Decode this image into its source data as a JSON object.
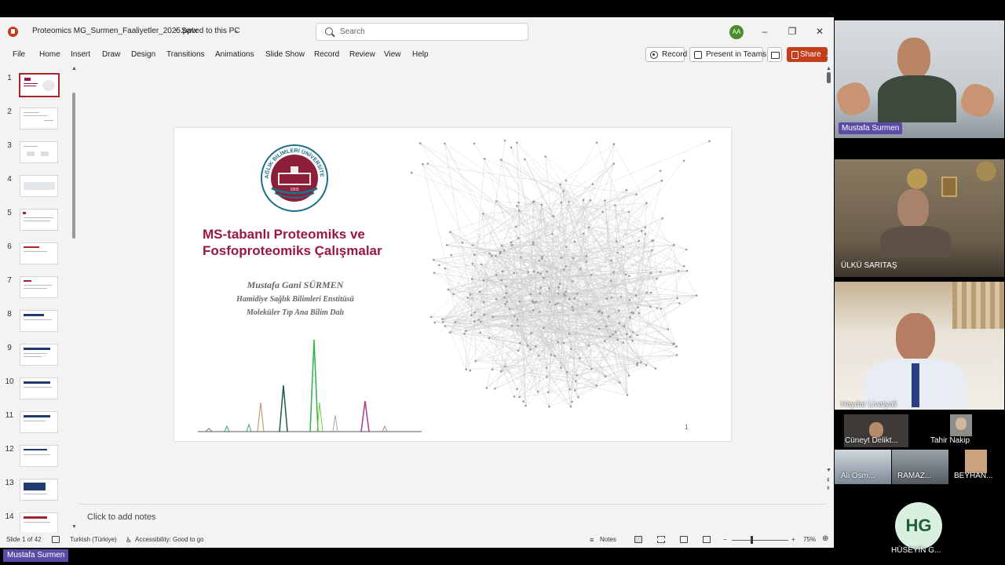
{
  "window": {
    "doc_title": "Proteomics MG_Surmen_Faaliyetler_2025.pptx",
    "separator": "•",
    "saved_status": "Saved to this PC",
    "search_placeholder": "Search",
    "user_initials": "AA"
  },
  "menu": {
    "items": [
      "File",
      "Home",
      "Insert",
      "Draw",
      "Design",
      "Transitions",
      "Animations",
      "Slide Show",
      "Record",
      "Review",
      "View",
      "Help"
    ],
    "record_label": "Record",
    "present_label": "Present in Teams",
    "share_label": "Share"
  },
  "thumbnails": {
    "numbers": [
      "1",
      "2",
      "3",
      "4",
      "5",
      "6",
      "7",
      "8",
      "9",
      "10",
      "11",
      "12",
      "13",
      "14"
    ],
    "active_index": 1
  },
  "slide": {
    "title_line1": "MS-tabanlı Proteomiks ve",
    "title_line2": "Fosfoproteomiks Çalışmalar",
    "author": "Mustafa Gani SÜRMEN",
    "institute": "Hamidiye Sağlık Bilimleri Enstitüsü",
    "department": "Moleküler Tıp Ana Bilim Dalı",
    "seal_text": "SAĞLIK BİLİMLERİ ÜNİVERSİTESİ",
    "seal_year": "1903",
    "page_number": "1",
    "title_color": "#9b1742"
  },
  "notes": {
    "placeholder": "Click to add notes"
  },
  "status": {
    "slide_info": "Slide 1 of 42",
    "language": "Turkish (Türkiye)",
    "accessibility": "Accessibility: Good to go",
    "notes_label": "Notes",
    "zoom": "75%",
    "zoom_minus": "−",
    "zoom_plus": "+"
  },
  "participants": {
    "main": [
      {
        "name": "Mustafa Surmen"
      },
      {
        "name": "ÜLKÜ SARITAŞ"
      },
      {
        "name": "Haydar Livatyali"
      }
    ],
    "small": [
      {
        "name": "Cüneyt Delikt..."
      },
      {
        "name": "Tahir Nakip"
      },
      {
        "name": "Ali Osm..."
      },
      {
        "name": "RAMAZ..."
      },
      {
        "name": "BEYHAN..."
      }
    ],
    "avatar": {
      "initials": "HG",
      "name": "HÜSEYİN G..."
    },
    "presenter_tag": "Mustafa Surmen"
  },
  "colors": {
    "accent": "#c43e1c",
    "teams_purple": "#5b4aa6"
  }
}
